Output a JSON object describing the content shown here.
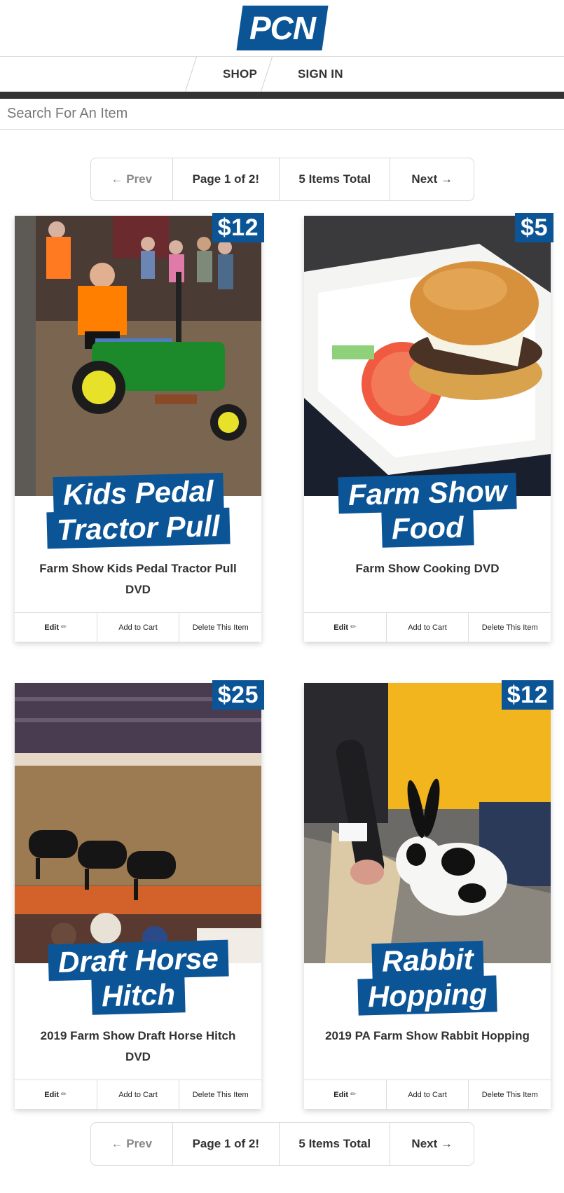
{
  "header": {
    "logo_text": "PCN",
    "brand_color": "#0b5597"
  },
  "nav": {
    "items": [
      {
        "label": "SHOP"
      },
      {
        "label": "SIGN IN"
      }
    ]
  },
  "search": {
    "placeholder": "Search For An Item"
  },
  "pagination": {
    "prev_label": "← Prev",
    "page_label": "Page 1 of 2!",
    "total_label": "5 Items Total",
    "next_label": "Next →"
  },
  "products": [
    {
      "price": "$12",
      "banner_lines": [
        "Kids Pedal",
        "Tractor Pull"
      ],
      "title": "Farm Show Kids Pedal Tractor Pull DVD",
      "image_icon": "tractor-photo-icon",
      "actions": {
        "edit": "Edit",
        "edit_icon": "✏",
        "add": "Add to Cart",
        "delete": "Delete This Item"
      }
    },
    {
      "price": "$5",
      "banner_lines": [
        "Farm Show",
        "Food"
      ],
      "title": "Farm Show Cooking DVD",
      "image_icon": "burger-photo-icon",
      "actions": {
        "edit": "Edit",
        "edit_icon": "✏",
        "add": "Add to Cart",
        "delete": "Delete This Item"
      }
    },
    {
      "price": "$25",
      "banner_lines": [
        "Draft Horse",
        "Hitch"
      ],
      "title": "2019 Farm Show Draft Horse Hitch DVD",
      "image_icon": "horse-arena-photo-icon",
      "actions": {
        "edit": "Edit",
        "edit_icon": "✏",
        "add": "Add to Cart",
        "delete": "Delete This Item"
      }
    },
    {
      "price": "$12",
      "banner_lines": [
        "Rabbit",
        "Hopping"
      ],
      "title": "2019 PA Farm Show Rabbit Hopping",
      "image_icon": "rabbit-photo-icon",
      "actions": {
        "edit": "Edit",
        "edit_icon": "✏",
        "add": "Add to Cart",
        "delete": "Delete This Item"
      }
    }
  ]
}
